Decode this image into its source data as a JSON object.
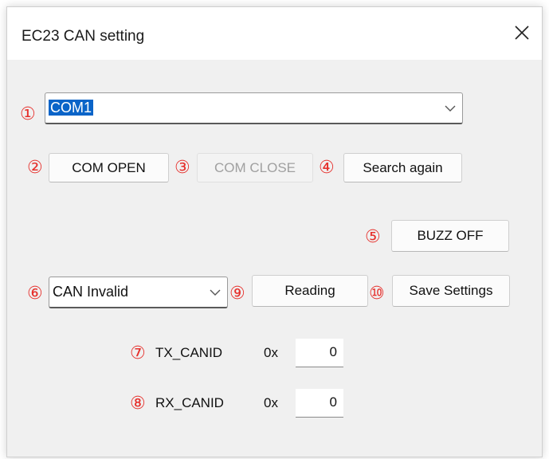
{
  "window": {
    "title": "EC23 CAN setting"
  },
  "markers": [
    "①",
    "②",
    "③",
    "④",
    "⑤",
    "⑥",
    "⑦",
    "⑧",
    "⑨",
    "⑩"
  ],
  "port_select": {
    "value": "COM1"
  },
  "buttons": {
    "com_open": "COM OPEN",
    "com_close": "COM CLOSE",
    "search_again": "Search again",
    "buzz_off": "BUZZ OFF",
    "reading": "Reading",
    "save_settings": "Save Settings"
  },
  "can_select": {
    "value": "CAN Invalid"
  },
  "tx": {
    "label": "TX_CANID",
    "prefix": "0x",
    "value": "0"
  },
  "rx": {
    "label": "RX_CANID",
    "prefix": "0x",
    "value": "0"
  },
  "colors": {
    "marker": "#e6302c",
    "selection": "#0a64c8"
  },
  "icons": {
    "close": "close-icon",
    "dropdown": "chevron-down-icon"
  }
}
